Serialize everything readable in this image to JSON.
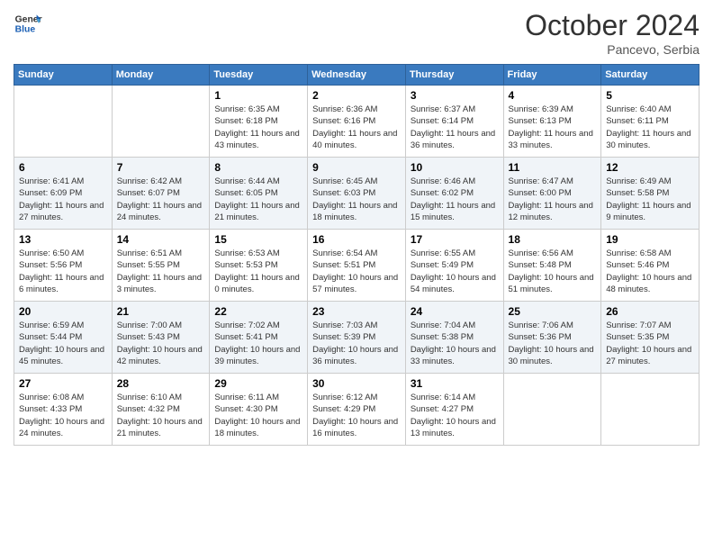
{
  "header": {
    "logo_line1": "General",
    "logo_line2": "Blue",
    "month": "October 2024",
    "location": "Pancevo, Serbia"
  },
  "weekdays": [
    "Sunday",
    "Monday",
    "Tuesday",
    "Wednesday",
    "Thursday",
    "Friday",
    "Saturday"
  ],
  "weeks": [
    [
      {
        "day": "",
        "info": ""
      },
      {
        "day": "",
        "info": ""
      },
      {
        "day": "1",
        "info": "Sunrise: 6:35 AM\nSunset: 6:18 PM\nDaylight: 11 hours and 43 minutes."
      },
      {
        "day": "2",
        "info": "Sunrise: 6:36 AM\nSunset: 6:16 PM\nDaylight: 11 hours and 40 minutes."
      },
      {
        "day": "3",
        "info": "Sunrise: 6:37 AM\nSunset: 6:14 PM\nDaylight: 11 hours and 36 minutes."
      },
      {
        "day": "4",
        "info": "Sunrise: 6:39 AM\nSunset: 6:13 PM\nDaylight: 11 hours and 33 minutes."
      },
      {
        "day": "5",
        "info": "Sunrise: 6:40 AM\nSunset: 6:11 PM\nDaylight: 11 hours and 30 minutes."
      }
    ],
    [
      {
        "day": "6",
        "info": "Sunrise: 6:41 AM\nSunset: 6:09 PM\nDaylight: 11 hours and 27 minutes."
      },
      {
        "day": "7",
        "info": "Sunrise: 6:42 AM\nSunset: 6:07 PM\nDaylight: 11 hours and 24 minutes."
      },
      {
        "day": "8",
        "info": "Sunrise: 6:44 AM\nSunset: 6:05 PM\nDaylight: 11 hours and 21 minutes."
      },
      {
        "day": "9",
        "info": "Sunrise: 6:45 AM\nSunset: 6:03 PM\nDaylight: 11 hours and 18 minutes."
      },
      {
        "day": "10",
        "info": "Sunrise: 6:46 AM\nSunset: 6:02 PM\nDaylight: 11 hours and 15 minutes."
      },
      {
        "day": "11",
        "info": "Sunrise: 6:47 AM\nSunset: 6:00 PM\nDaylight: 11 hours and 12 minutes."
      },
      {
        "day": "12",
        "info": "Sunrise: 6:49 AM\nSunset: 5:58 PM\nDaylight: 11 hours and 9 minutes."
      }
    ],
    [
      {
        "day": "13",
        "info": "Sunrise: 6:50 AM\nSunset: 5:56 PM\nDaylight: 11 hours and 6 minutes."
      },
      {
        "day": "14",
        "info": "Sunrise: 6:51 AM\nSunset: 5:55 PM\nDaylight: 11 hours and 3 minutes."
      },
      {
        "day": "15",
        "info": "Sunrise: 6:53 AM\nSunset: 5:53 PM\nDaylight: 11 hours and 0 minutes."
      },
      {
        "day": "16",
        "info": "Sunrise: 6:54 AM\nSunset: 5:51 PM\nDaylight: 10 hours and 57 minutes."
      },
      {
        "day": "17",
        "info": "Sunrise: 6:55 AM\nSunset: 5:49 PM\nDaylight: 10 hours and 54 minutes."
      },
      {
        "day": "18",
        "info": "Sunrise: 6:56 AM\nSunset: 5:48 PM\nDaylight: 10 hours and 51 minutes."
      },
      {
        "day": "19",
        "info": "Sunrise: 6:58 AM\nSunset: 5:46 PM\nDaylight: 10 hours and 48 minutes."
      }
    ],
    [
      {
        "day": "20",
        "info": "Sunrise: 6:59 AM\nSunset: 5:44 PM\nDaylight: 10 hours and 45 minutes."
      },
      {
        "day": "21",
        "info": "Sunrise: 7:00 AM\nSunset: 5:43 PM\nDaylight: 10 hours and 42 minutes."
      },
      {
        "day": "22",
        "info": "Sunrise: 7:02 AM\nSunset: 5:41 PM\nDaylight: 10 hours and 39 minutes."
      },
      {
        "day": "23",
        "info": "Sunrise: 7:03 AM\nSunset: 5:39 PM\nDaylight: 10 hours and 36 minutes."
      },
      {
        "day": "24",
        "info": "Sunrise: 7:04 AM\nSunset: 5:38 PM\nDaylight: 10 hours and 33 minutes."
      },
      {
        "day": "25",
        "info": "Sunrise: 7:06 AM\nSunset: 5:36 PM\nDaylight: 10 hours and 30 minutes."
      },
      {
        "day": "26",
        "info": "Sunrise: 7:07 AM\nSunset: 5:35 PM\nDaylight: 10 hours and 27 minutes."
      }
    ],
    [
      {
        "day": "27",
        "info": "Sunrise: 6:08 AM\nSunset: 4:33 PM\nDaylight: 10 hours and 24 minutes."
      },
      {
        "day": "28",
        "info": "Sunrise: 6:10 AM\nSunset: 4:32 PM\nDaylight: 10 hours and 21 minutes."
      },
      {
        "day": "29",
        "info": "Sunrise: 6:11 AM\nSunset: 4:30 PM\nDaylight: 10 hours and 18 minutes."
      },
      {
        "day": "30",
        "info": "Sunrise: 6:12 AM\nSunset: 4:29 PM\nDaylight: 10 hours and 16 minutes."
      },
      {
        "day": "31",
        "info": "Sunrise: 6:14 AM\nSunset: 4:27 PM\nDaylight: 10 hours and 13 minutes."
      },
      {
        "day": "",
        "info": ""
      },
      {
        "day": "",
        "info": ""
      }
    ]
  ]
}
